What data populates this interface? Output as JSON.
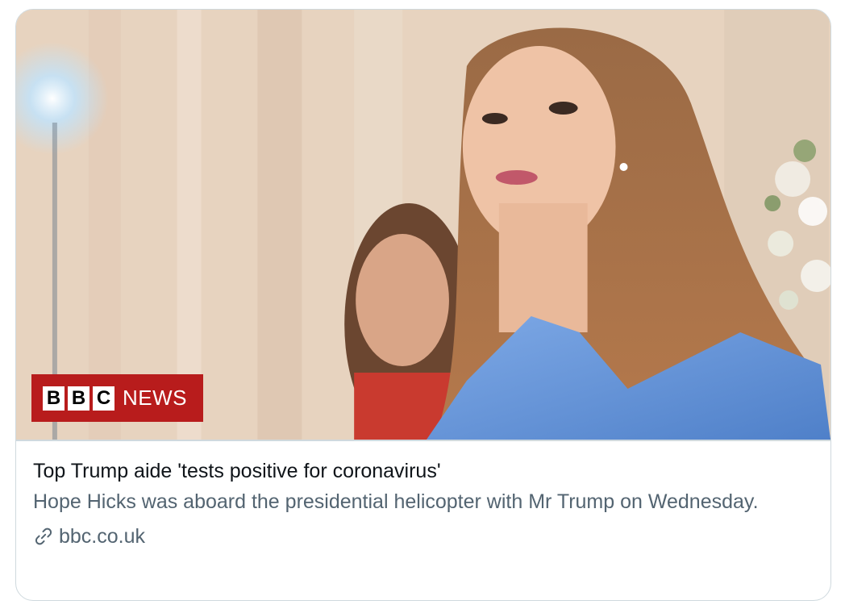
{
  "card": {
    "logo": {
      "letters": [
        "B",
        "B",
        "C"
      ],
      "word": "NEWS",
      "brand_color": "#b81c1c"
    },
    "title": "Top Trump aide 'tests positive for coronavirus'",
    "description": "Hope Hicks was aboard the presidential helicopter with Mr Trump on Wednesday.",
    "domain": "bbc.co.uk",
    "icons": {
      "link": "link-icon"
    }
  },
  "colors": {
    "title": "#0f1419",
    "secondary": "#536471",
    "border": "#cfd9de"
  }
}
